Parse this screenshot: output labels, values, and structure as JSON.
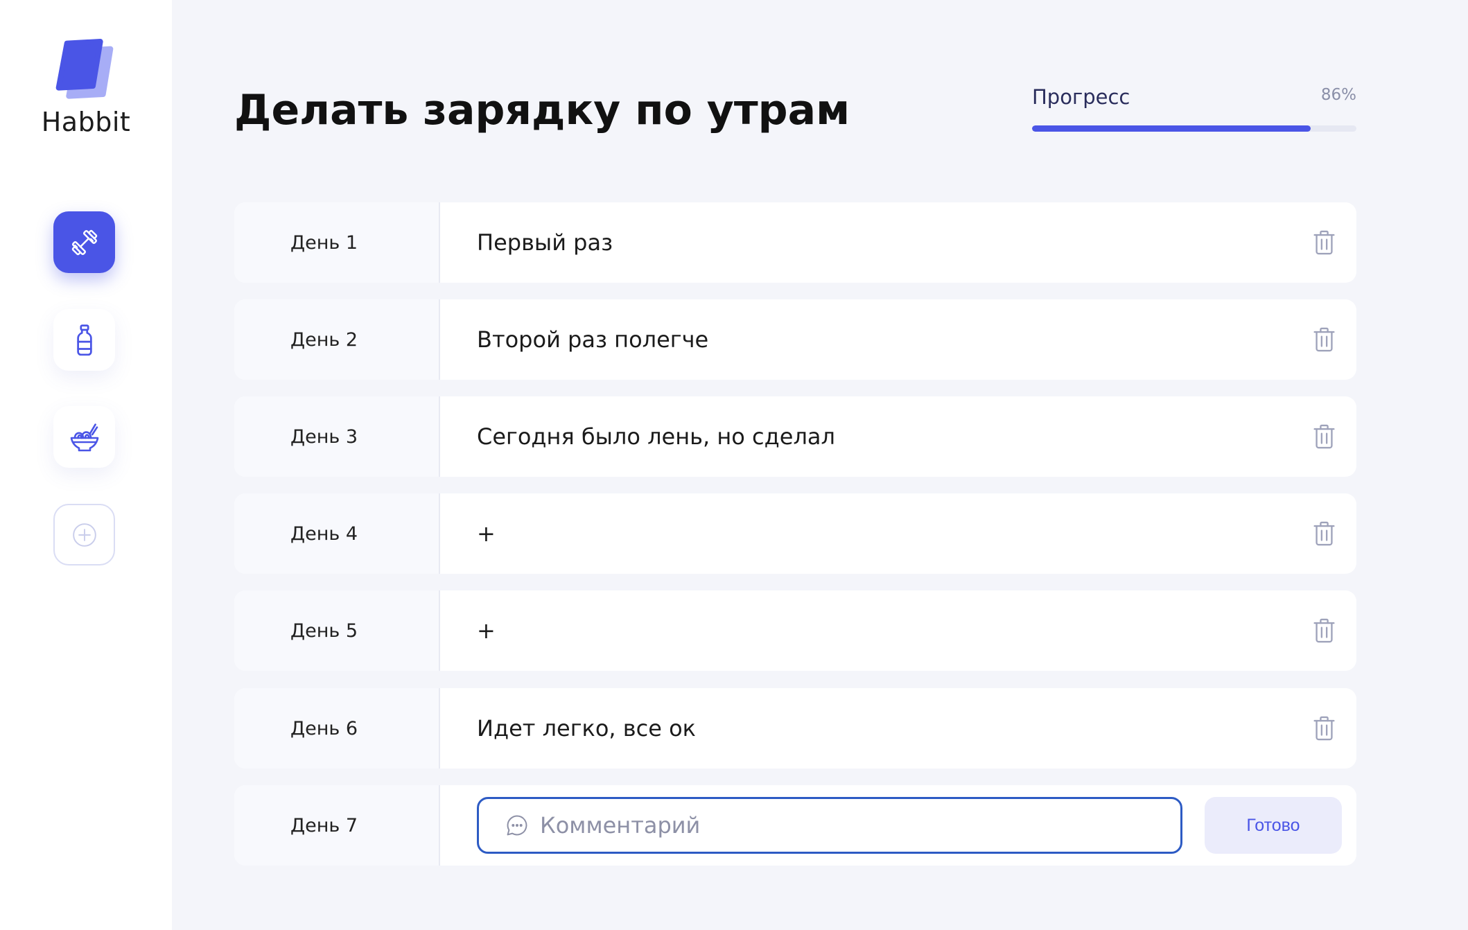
{
  "app": {
    "name": "Habbit"
  },
  "colors": {
    "accent": "#4A55E6",
    "focus": "#2D5BC4"
  },
  "sidebar": {
    "items": [
      {
        "icon": "dumbbell-icon",
        "active": true
      },
      {
        "icon": "bottle-icon",
        "active": false
      },
      {
        "icon": "food-bowl-icon",
        "active": false
      },
      {
        "icon": "add-circle-icon",
        "active": false
      }
    ]
  },
  "header": {
    "title": "Делать зарядку по утрам",
    "progress": {
      "label": "Прогресс",
      "value_text": "86%",
      "value": 86
    }
  },
  "days": [
    {
      "label": "День 1",
      "comment": "Первый раз"
    },
    {
      "label": "День 2",
      "comment": "Второй раз полегче"
    },
    {
      "label": "День 3",
      "comment": "Сегодня было лень, но сделал"
    },
    {
      "label": "День 4",
      "comment": "+"
    },
    {
      "label": "День 5",
      "comment": "+"
    },
    {
      "label": "День 6",
      "comment": "Идет легко, все ок"
    }
  ],
  "current_day": {
    "label": "День 7",
    "placeholder": "Комментарий",
    "submit_label": "Готово"
  }
}
